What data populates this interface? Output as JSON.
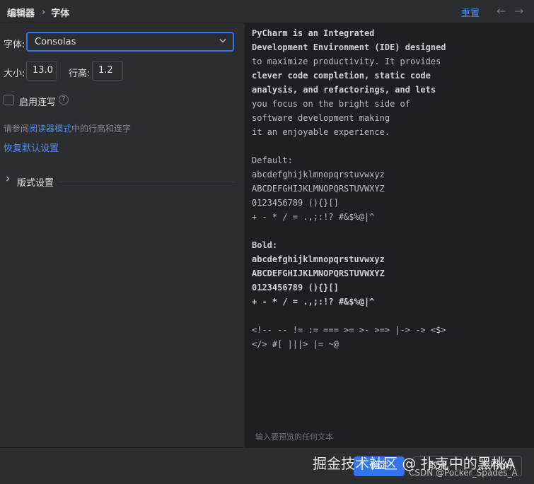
{
  "header": {
    "breadcrumb_parent": "编辑器",
    "breadcrumb_current": "字体",
    "reset_label": "重置",
    "back_glyph": "←",
    "forward_glyph": "→"
  },
  "form": {
    "font_label": "字体:",
    "font_value": "Consolas",
    "size_label": "大小:",
    "size_value": "13.0",
    "line_height_label": "行高:",
    "line_height_value": "1.2",
    "ligatures_label": "启用连写",
    "ligatures_checked": false,
    "hint_prefix": "请参阅",
    "hint_link": "阅读器模式",
    "hint_suffix": "中的行高和连字",
    "restore_defaults": "恢复默认设置",
    "typography_section": "版式设置"
  },
  "preview": {
    "lines": [
      {
        "text": "PyCharm is an Integrated",
        "bold": true
      },
      {
        "text": "Development Environment (IDE) designed",
        "bold": true
      },
      {
        "text": "to maximize productivity. It provides",
        "bold": false
      },
      {
        "text": "clever code completion, static code",
        "bold": true
      },
      {
        "text": "analysis, and refactorings, and lets",
        "bold": true
      },
      {
        "text": "you focus on the bright side of",
        "bold": false
      },
      {
        "text": "software development making",
        "bold": false
      },
      {
        "text": "it an enjoyable experience.",
        "bold": false
      },
      {
        "text": "",
        "bold": false
      },
      {
        "text": "Default:",
        "bold": false
      },
      {
        "text": "abcdefghijklmnopqrstuvwxyz",
        "bold": false
      },
      {
        "text": "ABCDEFGHIJKLMNOPQRSTUVWXYZ",
        "bold": false
      },
      {
        "text": "0123456789 (){}[]",
        "bold": false
      },
      {
        "text": "+ - * / = .,;:!? #&$%@|^",
        "bold": false
      },
      {
        "text": "",
        "bold": false
      },
      {
        "text": "Bold:",
        "bold": true
      },
      {
        "text": "abcdefghijklmnopqrstuvwxyz",
        "bold": true
      },
      {
        "text": "ABCDEFGHIJKLMNOPQRSTUVWXYZ",
        "bold": true
      },
      {
        "text": "0123456789 (){}[]",
        "bold": true
      },
      {
        "text": "+ - * / = .,;:!? #&$%@|^",
        "bold": true
      },
      {
        "text": "",
        "bold": false
      },
      {
        "text": "<!-- -- != := === >= >- >=> |-> -> <$>",
        "bold": false
      },
      {
        "text": "</> #[ |||> |= ~@",
        "bold": false
      }
    ],
    "placeholder": "输入要预览的任何文本"
  },
  "footer": {
    "ok_label": "确定",
    "cancel_label": "取消",
    "apply_label": "应用(A)"
  },
  "watermark": {
    "main": "掘金技术社区 @ 扑克中的黑桃A",
    "sub": "CSDN @Pocker_Spades_A"
  },
  "colors": {
    "accent": "#3574f0",
    "link": "#548af7",
    "background": "#2b2d30",
    "editor_background": "#1e1f22"
  }
}
